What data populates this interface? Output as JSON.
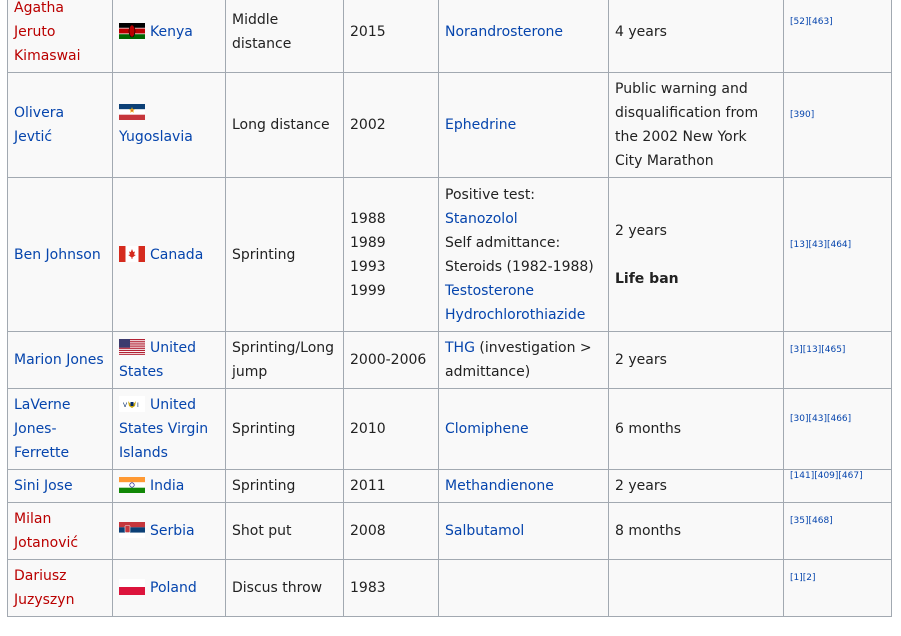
{
  "rows": [
    {
      "name": "Agatha Jeruto Kimaswai",
      "name_red": true,
      "country": "Kenya",
      "flag": "kenya",
      "event": "Middle distance",
      "years": [
        "2015"
      ],
      "substance": [
        {
          "text": "Norandrosterone",
          "link": true
        }
      ],
      "sanction": [
        "4 years"
      ],
      "refs": [
        "[52]",
        "[463]"
      ]
    },
    {
      "name": "Olivera Jevtić",
      "name_red": false,
      "country": "Yugoslavia",
      "flag": "yugoslavia",
      "event": "Long distance",
      "years": [
        "2002"
      ],
      "substance": [
        {
          "text": "Ephedrine",
          "link": true
        }
      ],
      "sanction": [
        "Public warning and disqualification from the 2002 New York City Marathon"
      ],
      "refs": [
        "[390]"
      ]
    },
    {
      "name": "Ben Johnson",
      "name_red": false,
      "country": "Canada",
      "flag": "canada",
      "event": "Sprinting",
      "years": [
        "1988",
        "1989",
        "1993",
        "1999"
      ],
      "substance": [
        {
          "text": "Positive test:",
          "link": false
        },
        {
          "text": "Stanozolol",
          "link": true
        },
        {
          "text": "Self admittance:",
          "link": false
        },
        {
          "text": "Steroids (1982-1988)",
          "link": false
        },
        {
          "text": "Testosterone",
          "link": true
        },
        {
          "text": "Hydrochlorothiazide",
          "link": true
        }
      ],
      "sanction": [
        "2 years",
        "Life ban"
      ],
      "refs": [
        "[13]",
        "[43]",
        "[464]"
      ]
    },
    {
      "name": "Marion Jones",
      "name_red": false,
      "country": "United States",
      "flag": "usa",
      "event": "Sprinting/Long jump",
      "years": [
        "2000-2006"
      ],
      "substance": [
        {
          "text": "THG",
          "link": true
        },
        {
          "text": " (investigation > admittance)",
          "link": false
        }
      ],
      "sanction": [
        "2 years"
      ],
      "refs": [
        "[3]",
        "[13]",
        "[465]"
      ]
    },
    {
      "name": "LaVerne Jones-Ferrette",
      "name_red": false,
      "country": "United States Virgin Islands",
      "flag": "usvi",
      "event": "Sprinting",
      "years": [
        "2010"
      ],
      "substance": [
        {
          "text": "Clomiphene",
          "link": true
        }
      ],
      "sanction": [
        "6 months"
      ],
      "refs": [
        "[30]",
        "[43]",
        "[466]"
      ]
    },
    {
      "name": "Sini Jose",
      "name_red": false,
      "country": "India",
      "flag": "india",
      "event": "Sprinting",
      "years": [
        "2011"
      ],
      "substance": [
        {
          "text": "Methandienone",
          "link": true
        }
      ],
      "sanction": [
        "2 years"
      ],
      "refs": [
        "[141]",
        "[409]",
        "[467]"
      ]
    },
    {
      "name": "Milan Jotanović",
      "name_red": true,
      "country": "Serbia",
      "flag": "serbia",
      "event": "Shot put",
      "years": [
        "2008"
      ],
      "substance": [
        {
          "text": "Salbutamol",
          "link": true
        }
      ],
      "sanction": [
        "8 months"
      ],
      "refs": [
        "[35]",
        "[468]"
      ]
    },
    {
      "name": "Dariusz Juzyszyn",
      "name_red": true,
      "country": "Poland",
      "flag": "poland",
      "event": "Discus throw",
      "years": [
        "1983"
      ],
      "substance": [],
      "sanction": [],
      "refs": [
        "[1]",
        "[2]"
      ]
    }
  ]
}
